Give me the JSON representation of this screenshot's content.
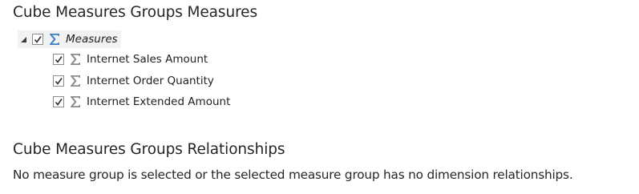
{
  "measure_groups": {
    "title": "Cube Measures Groups Measures",
    "root": {
      "label": "Measures",
      "expanded": true,
      "checked": true,
      "icon": "sigma-icon",
      "icon_color": "#3b7fc4"
    },
    "children": [
      {
        "label": "Internet Sales Amount",
        "checked": true,
        "icon": "sigma-icon"
      },
      {
        "label": "Internet Order Quantity",
        "checked": true,
        "icon": "sigma-icon"
      },
      {
        "label": "Internet Extended Amount",
        "checked": true,
        "icon": "sigma-icon"
      }
    ],
    "child_icon_color": "#8a8a8a"
  },
  "relationships": {
    "title": "Cube Measures Groups Relationships",
    "message": "No measure group is selected or the selected measure group has no dimension relationships."
  }
}
